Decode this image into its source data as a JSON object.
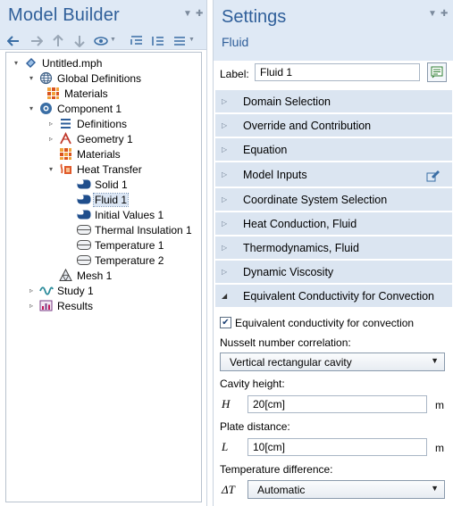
{
  "model_builder": {
    "title": "Model Builder",
    "tree": [
      {
        "label": "Untitled.mph",
        "icon": "model-file-icon",
        "toggle": "▾"
      },
      {
        "label": "Global Definitions",
        "icon": "globe-icon",
        "toggle": "▾"
      },
      {
        "label": "Materials",
        "icon": "materials-icon",
        "toggle": ""
      },
      {
        "label": "Component 1",
        "icon": "component-icon",
        "toggle": "▾"
      },
      {
        "label": "Definitions",
        "icon": "definitions-icon",
        "toggle": "▹"
      },
      {
        "label": "Geometry 1",
        "icon": "geometry-icon",
        "toggle": "▹"
      },
      {
        "label": "Materials",
        "icon": "materials-icon",
        "toggle": ""
      },
      {
        "label": "Heat Transfer",
        "icon": "heat-transfer-icon",
        "toggle": "▾"
      },
      {
        "label": "Solid 1",
        "icon": "domain-node-icon",
        "toggle": ""
      },
      {
        "label": "Fluid 1",
        "icon": "domain-node-icon",
        "toggle": ""
      },
      {
        "label": "Initial Values 1",
        "icon": "domain-node-icon",
        "toggle": ""
      },
      {
        "label": "Thermal Insulation 1",
        "icon": "boundary-node-icon",
        "toggle": ""
      },
      {
        "label": "Temperature 1",
        "icon": "boundary-node-icon",
        "toggle": ""
      },
      {
        "label": "Temperature 2",
        "icon": "boundary-node-icon",
        "toggle": ""
      },
      {
        "label": "Mesh 1",
        "icon": "mesh-icon",
        "toggle": ""
      },
      {
        "label": "Study 1",
        "icon": "study-icon",
        "toggle": "▹"
      },
      {
        "label": "Results",
        "icon": "results-icon",
        "toggle": "▹"
      }
    ]
  },
  "settings": {
    "title": "Settings",
    "subtitle": "Fluid",
    "label_caption": "Label:",
    "label_value": "Fluid 1",
    "sections": [
      {
        "label": "Domain Selection",
        "expanded": false
      },
      {
        "label": "Override and Contribution",
        "expanded": false
      },
      {
        "label": "Equation",
        "expanded": false
      },
      {
        "label": "Model Inputs",
        "expanded": false
      },
      {
        "label": "Coordinate System Selection",
        "expanded": false
      },
      {
        "label": "Heat Conduction, Fluid",
        "expanded": false
      },
      {
        "label": "Thermodynamics, Fluid",
        "expanded": false
      },
      {
        "label": "Dynamic Viscosity",
        "expanded": false
      },
      {
        "label": "Equivalent Conductivity for Convection",
        "expanded": true
      }
    ],
    "equiv": {
      "checkbox_label": "Equivalent conductivity for convection",
      "checked": true,
      "nusselt_label": "Nusselt number correlation:",
      "nusselt_value": "Vertical rectangular cavity",
      "cavity_height_label": "Cavity height:",
      "cavity_height_symbol": "H",
      "cavity_height_value": "20[cm]",
      "cavity_height_unit": "m",
      "plate_distance_label": "Plate distance:",
      "plate_distance_symbol": "L",
      "plate_distance_value": "10[cm]",
      "plate_distance_unit": "m",
      "temp_diff_label": "Temperature difference:",
      "temp_diff_symbol": "ΔT",
      "temp_diff_value": "Automatic"
    }
  },
  "colors": {
    "header_bg": "#dfe9f5",
    "section_bg": "#dbe5f1",
    "title_blue": "#2f5f9a"
  }
}
